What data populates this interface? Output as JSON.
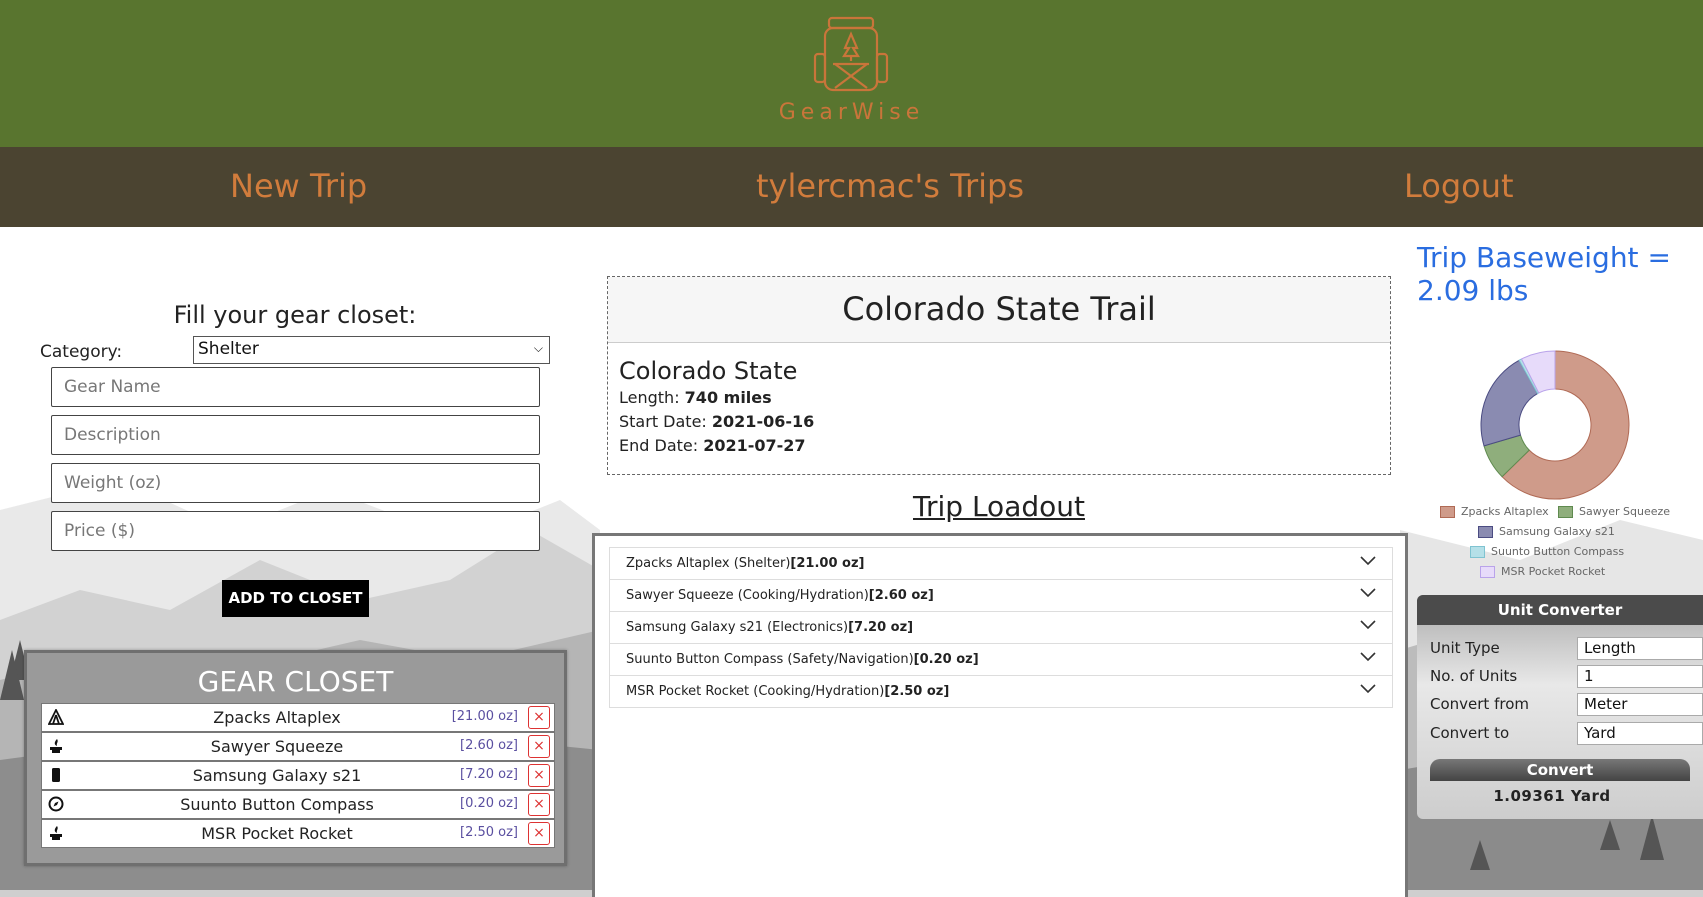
{
  "brand": {
    "name": "GearWise"
  },
  "nav": {
    "new_trip": "New Trip",
    "my_trips": "tylercmac's Trips",
    "logout": "Logout"
  },
  "form": {
    "title": "Fill your gear closet:",
    "category_label": "Category:",
    "category_value": "Shelter",
    "gear_name_placeholder": "Gear Name",
    "description_placeholder": "Description",
    "weight_placeholder": "Weight (oz)",
    "price_placeholder": "Price ($)",
    "add_button": "ADD TO CLOSET"
  },
  "closet": {
    "title": "GEAR CLOSET",
    "items": [
      {
        "name": "Zpacks Altaplex",
        "weight": "[21.00 oz]",
        "icon": "tent-icon",
        "remove": "×"
      },
      {
        "name": "Sawyer Squeeze",
        "weight": "[2.60 oz]",
        "icon": "stove-icon",
        "remove": "×"
      },
      {
        "name": "Samsung Galaxy s21",
        "weight": "[7.20 oz]",
        "icon": "phone-icon",
        "remove": "×"
      },
      {
        "name": "Suunto Button Compass",
        "weight": "[0.20 oz]",
        "icon": "compass-icon",
        "remove": "×"
      },
      {
        "name": "MSR Pocket Rocket",
        "weight": "[2.50 oz]",
        "icon": "stove-icon",
        "remove": "×"
      }
    ]
  },
  "trip": {
    "title": "Colorado State Trail",
    "location": "Colorado State",
    "length_label": "Length:",
    "length_value": "740 miles",
    "start_label": "Start Date:",
    "start_value": "2021-06-16",
    "end_label": "End Date:",
    "end_value": "2021-07-27"
  },
  "loadout": {
    "title": "Trip Loadout",
    "items": [
      {
        "text": "Zpacks Altaplex (Shelter)",
        "weight": "[21.00 oz]"
      },
      {
        "text": "Sawyer Squeeze (Cooking/Hydration)",
        "weight": "[2.60 oz]"
      },
      {
        "text": "Samsung Galaxy s21 (Electronics)",
        "weight": "[7.20 oz]"
      },
      {
        "text": "Suunto Button Compass (Safety/Navigation)",
        "weight": "[0.20 oz]"
      },
      {
        "text": "MSR Pocket Rocket (Cooking/Hydration)",
        "weight": "[2.50 oz]"
      }
    ]
  },
  "baseweight": {
    "text": "Trip Baseweight = 2.09 lbs"
  },
  "chart_data": {
    "type": "pie",
    "title": "",
    "categories": [
      "Zpacks Altaplex",
      "Sawyer Squeeze",
      "Samsung Galaxy s21",
      "Suunto Button Compass",
      "MSR Pocket Rocket"
    ],
    "values": [
      21.0,
      2.6,
      7.2,
      0.2,
      2.5
    ],
    "colors": [
      "#cf9b8a",
      "#8fae7c",
      "#8a8bb1",
      "#b5e0e8",
      "#e7dbfa"
    ],
    "border_colors": [
      "#b06a55",
      "#5f8a4f",
      "#4b4c82",
      "#7fc3d1",
      "#b9a3ea"
    ],
    "donut": true,
    "legend_position": "bottom"
  },
  "converter": {
    "title": "Unit Converter",
    "unit_type_label": "Unit Type",
    "unit_type_value": "Length",
    "units_label": "No. of Units",
    "units_value": "1",
    "from_label": "Convert from",
    "from_value": "Meter",
    "to_label": "Convert to",
    "to_value": "Yard",
    "button": "Convert",
    "result": "1.09361 Yard"
  }
}
